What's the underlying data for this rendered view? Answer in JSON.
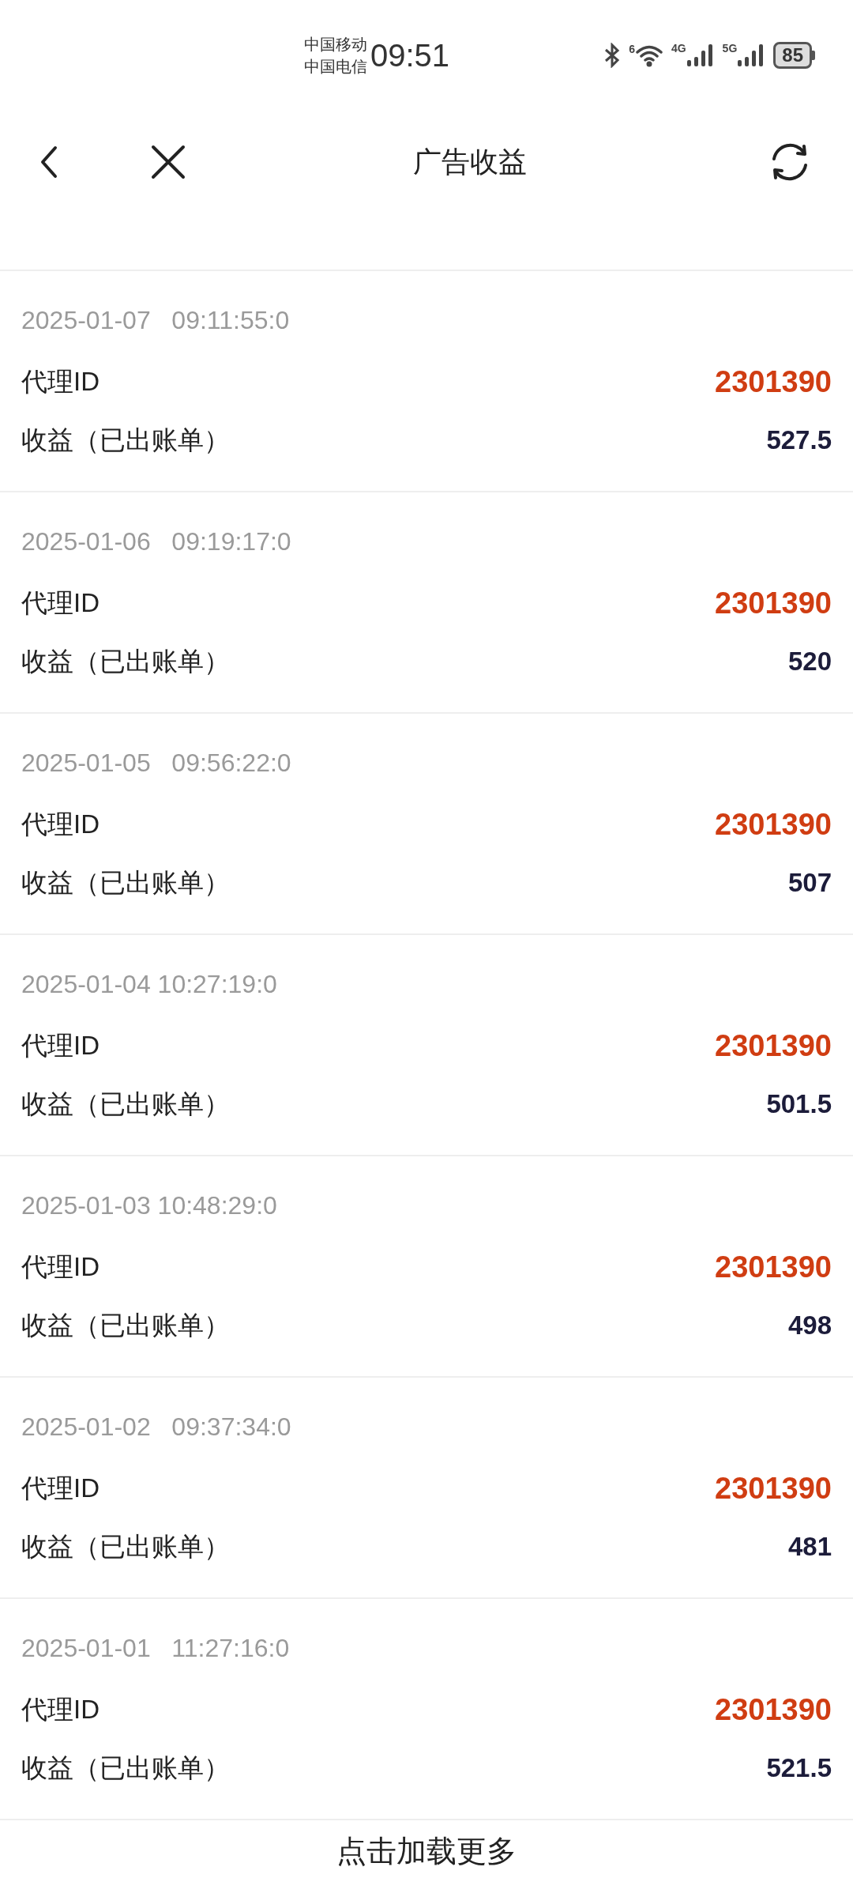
{
  "status_bar": {
    "carriers": [
      "中国移动",
      "中国电信"
    ],
    "time": "09:51",
    "wifi_badge": "6",
    "network_1": "4G",
    "network_2": "5G",
    "battery": "85"
  },
  "header": {
    "title": "广告收益"
  },
  "records": [
    {
      "timestamp": "2025-01-07   09:11:55:0",
      "id_label": "代理ID",
      "id": "2301390",
      "income_label": "收益（已出账单）",
      "income": "527.5"
    },
    {
      "timestamp": "2025-01-06   09:19:17:0",
      "id_label": "代理ID",
      "id": "2301390",
      "income_label": "收益（已出账单）",
      "income": "520"
    },
    {
      "timestamp": "2025-01-05   09:56:22:0",
      "id_label": "代理ID",
      "id": "2301390",
      "income_label": "收益（已出账单）",
      "income": "507"
    },
    {
      "timestamp": "2025-01-04 10:27:19:0",
      "id_label": "代理ID",
      "id": "2301390",
      "income_label": "收益（已出账单）",
      "income": "501.5"
    },
    {
      "timestamp": "2025-01-03 10:48:29:0",
      "id_label": "代理ID",
      "id": "2301390",
      "income_label": "收益（已出账单）",
      "income": "498"
    },
    {
      "timestamp": "2025-01-02   09:37:34:0",
      "id_label": "代理ID",
      "id": "2301390",
      "income_label": "收益（已出账单）",
      "income": "481"
    },
    {
      "timestamp": "2025-01-01   11:27:16:0",
      "id_label": "代理ID",
      "id": "2301390",
      "income_label": "收益（已出账单）",
      "income": "521.5"
    }
  ],
  "load_more": "点击加载更多"
}
